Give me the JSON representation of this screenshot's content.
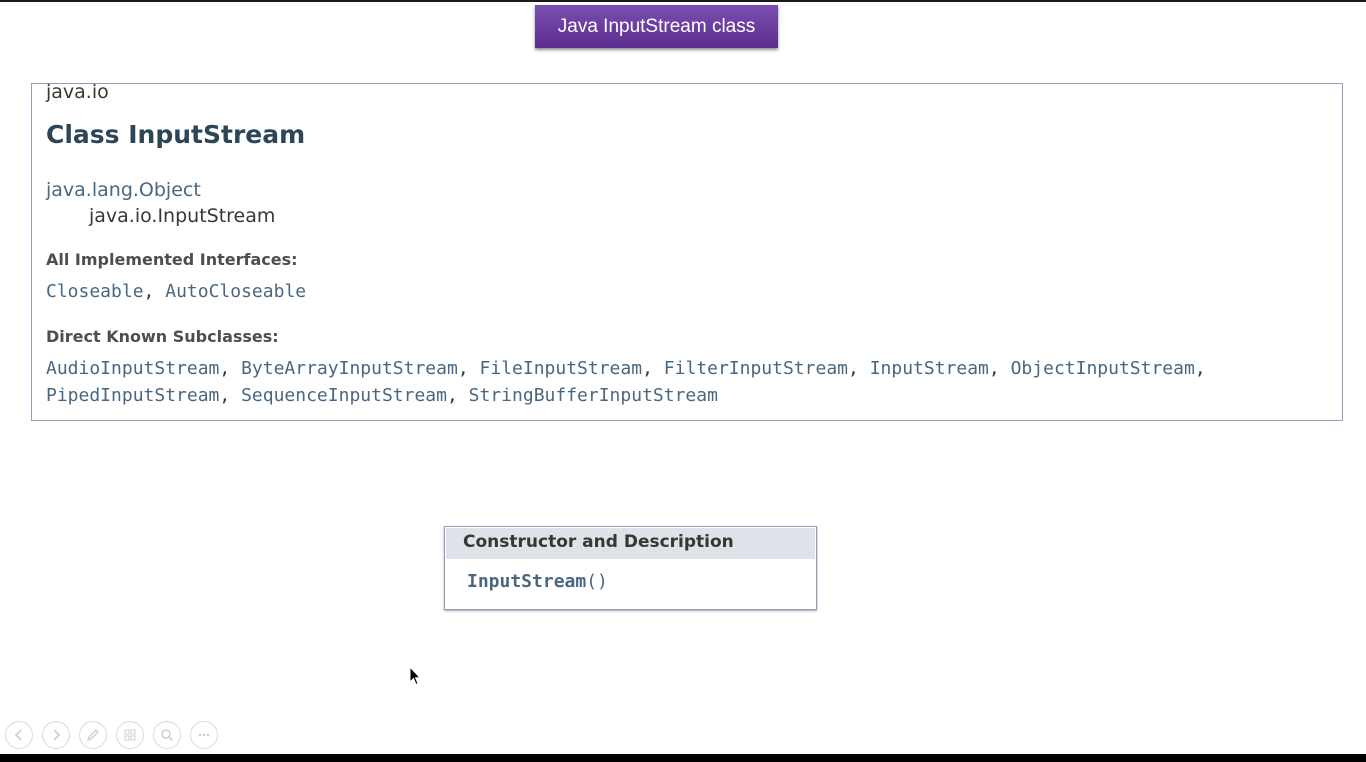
{
  "slide": {
    "title": "Java InputStream class"
  },
  "doc": {
    "package": "java.io",
    "class_title": "Class InputStream",
    "inheritance": {
      "parent": "java.lang.Object",
      "child": "java.io.InputStream"
    },
    "implemented_label": "All Implemented Interfaces:",
    "implemented": [
      "Closeable",
      "AutoCloseable"
    ],
    "subclasses_label": "Direct Known Subclasses:",
    "subclasses_line1": [
      "AudioInputStream",
      "ByteArrayInputStream",
      "FileInputStream",
      "FilterInputStream",
      "InputStream",
      "ObjectInputStream"
    ],
    "subclasses_line2": [
      "PipedInputStream",
      "SequenceInputStream",
      "StringBufferInputStream"
    ]
  },
  "constructor_table": {
    "header": "Constructor and Description",
    "name": "InputStream",
    "parens": "()"
  },
  "toolbar": {
    "icons": [
      "previous-icon",
      "next-icon",
      "pen-icon",
      "slides-icon",
      "zoom-icon",
      "more-icon"
    ]
  },
  "colors": {
    "banner": "#5b2d8e",
    "link": "#4a6782",
    "table_header": "#dee3e9"
  }
}
